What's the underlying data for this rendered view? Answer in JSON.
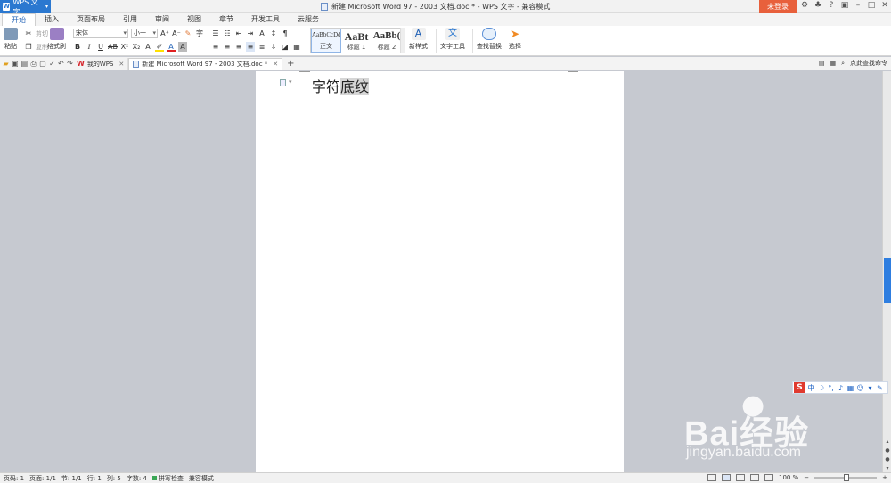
{
  "titlebar": {
    "app_name": "WPS 文字",
    "doc_title": "新建 Microsoft Word 97 - 2003 文档.doc * - WPS 文字 - 兼容模式",
    "login": "未登录"
  },
  "ribbon_tabs": [
    "开始",
    "插入",
    "页面布局",
    "引用",
    "审阅",
    "视图",
    "章节",
    "开发工具",
    "云服务"
  ],
  "ribbon": {
    "paste": "粘贴",
    "cut": "剪切",
    "copy": "复制",
    "format_painter": "格式刷",
    "font_name": "宋体",
    "font_size": "小一",
    "styles": [
      {
        "sample": "AaBbCcDd",
        "caption": "正文"
      },
      {
        "sample": "AaBt",
        "caption": "标题 1"
      },
      {
        "sample": "AaBb(",
        "caption": "标题 2"
      }
    ],
    "new_style": "新样式",
    "text_tools": "文字工具",
    "find_replace": "查找替换",
    "select": "选择"
  },
  "doc_tabs": [
    {
      "label": "我的WPS"
    },
    {
      "label": "新建 Microsoft Word 97 - 2003 文档.doc *"
    }
  ],
  "quickbar_right": {
    "search_hint": "点此查找命令"
  },
  "document": {
    "text_plain": "字符",
    "text_shaded": "底纹"
  },
  "statusbar": {
    "page_num": "页码: 1",
    "pages": "页面: 1/1",
    "section": "节: 1/1",
    "row": "行: 1",
    "col": "列: 5",
    "words": "字数: 4",
    "spellcheck": "拼写检查",
    "compat": "兼容模式",
    "zoom": "100 %"
  },
  "watermark": {
    "brand": "Bai经验",
    "site": "jingyan.baidu.com"
  }
}
